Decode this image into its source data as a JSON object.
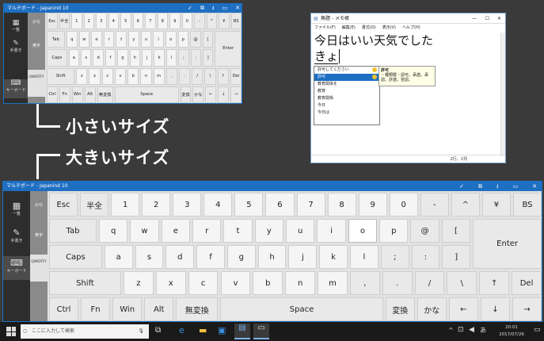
{
  "small_keyboard": {
    "title": "マルチボード - Japanind 10",
    "window_buttons": [
      "✓",
      "⧉",
      "⭳",
      "▭",
      "✕"
    ],
    "side": [
      {
        "label": "一覧"
      },
      {
        "label": "手書き"
      },
      {
        "label": "キーボード"
      }
    ],
    "tabs": [
      "かな",
      "英字",
      "QWERTY"
    ],
    "rows": [
      [
        "Esc",
        "半全",
        "1",
        "2",
        "3",
        "4",
        "5",
        "6",
        "7",
        "8",
        "9",
        "0",
        "-",
        "^",
        "¥",
        "BS"
      ],
      [
        "Tab",
        "q",
        "w",
        "e",
        "r",
        "t",
        "y",
        "u",
        "i",
        "o",
        "p",
        "@",
        "["
      ],
      [
        "Caps",
        "a",
        "s",
        "d",
        "f",
        "g",
        "h",
        "j",
        "k",
        "l",
        ";",
        ":",
        "]"
      ],
      [
        "Shift",
        "z",
        "x",
        "c",
        "v",
        "b",
        "n",
        "m",
        ",",
        ".",
        "/",
        "\\",
        "↑",
        "Del"
      ],
      [
        "Ctrl",
        "Fn",
        "Win",
        "Alt",
        "無変換",
        "Space",
        "変換",
        "かな",
        "←",
        "↓",
        "→"
      ]
    ],
    "enter": "Enter"
  },
  "notepad": {
    "title": "無題 - メモ帳",
    "menu": [
      "ファイル(F)",
      "編集(E)",
      "書式(O)",
      "表示(V)",
      "ヘルプ(H)"
    ],
    "line1": "今日はいい天気でした",
    "line2": "きょ",
    "status": "2行、1列"
  },
  "ime": {
    "candidates": [
      "許可してください",
      "許可",
      "教育関係を",
      "教育",
      "教育関係",
      "今日",
      "今日は"
    ],
    "tip_title": "許可",
    "tip_body": "・種類曖・認可。承諾。承認。許諾。容認。"
  },
  "callouts": {
    "small": "小さいサイズ",
    "large": "大きいサイズ"
  },
  "large_keyboard": {
    "title": "マルチボード - Japanind 10",
    "window_buttons": [
      "✓",
      "⧉",
      "⭳",
      "▭",
      "✕"
    ],
    "side": [
      {
        "label": "一覧"
      },
      {
        "label": "手書き"
      },
      {
        "label": "キーボード"
      }
    ],
    "tabs": [
      "かな",
      "英字",
      "QWERTY"
    ],
    "rows": [
      [
        "Esc",
        "半全",
        "1",
        "2",
        "3",
        "4",
        "5",
        "6",
        "7",
        "8",
        "9",
        "0",
        "-",
        "^",
        "¥",
        "BS"
      ],
      [
        "Tab",
        "q",
        "w",
        "e",
        "r",
        "t",
        "y",
        "u",
        "i",
        "o",
        "p",
        "@",
        "["
      ],
      [
        "Caps",
        "a",
        "s",
        "d",
        "f",
        "g",
        "h",
        "j",
        "k",
        "l",
        ";",
        ":",
        "]"
      ],
      [
        "Shift",
        "z",
        "x",
        "c",
        "v",
        "b",
        "n",
        "m",
        ",",
        ".",
        "/",
        "\\",
        "↑",
        "Del"
      ],
      [
        "Ctrl",
        "Fn",
        "Win",
        "Alt",
        "無変換",
        "Space",
        "変換",
        "かな",
        "←",
        "↓",
        "→"
      ]
    ],
    "enter": "Enter",
    "highlighted_key": "o"
  },
  "taskbar": {
    "search_placeholder": "ここに入力して検索",
    "time": "20:01",
    "date": "2017/07/26",
    "lang": "あ"
  },
  "colors": {
    "accent": "#1e6fc2",
    "taskbar": "#1a1a1a",
    "desktop": "#3a3a3a"
  }
}
